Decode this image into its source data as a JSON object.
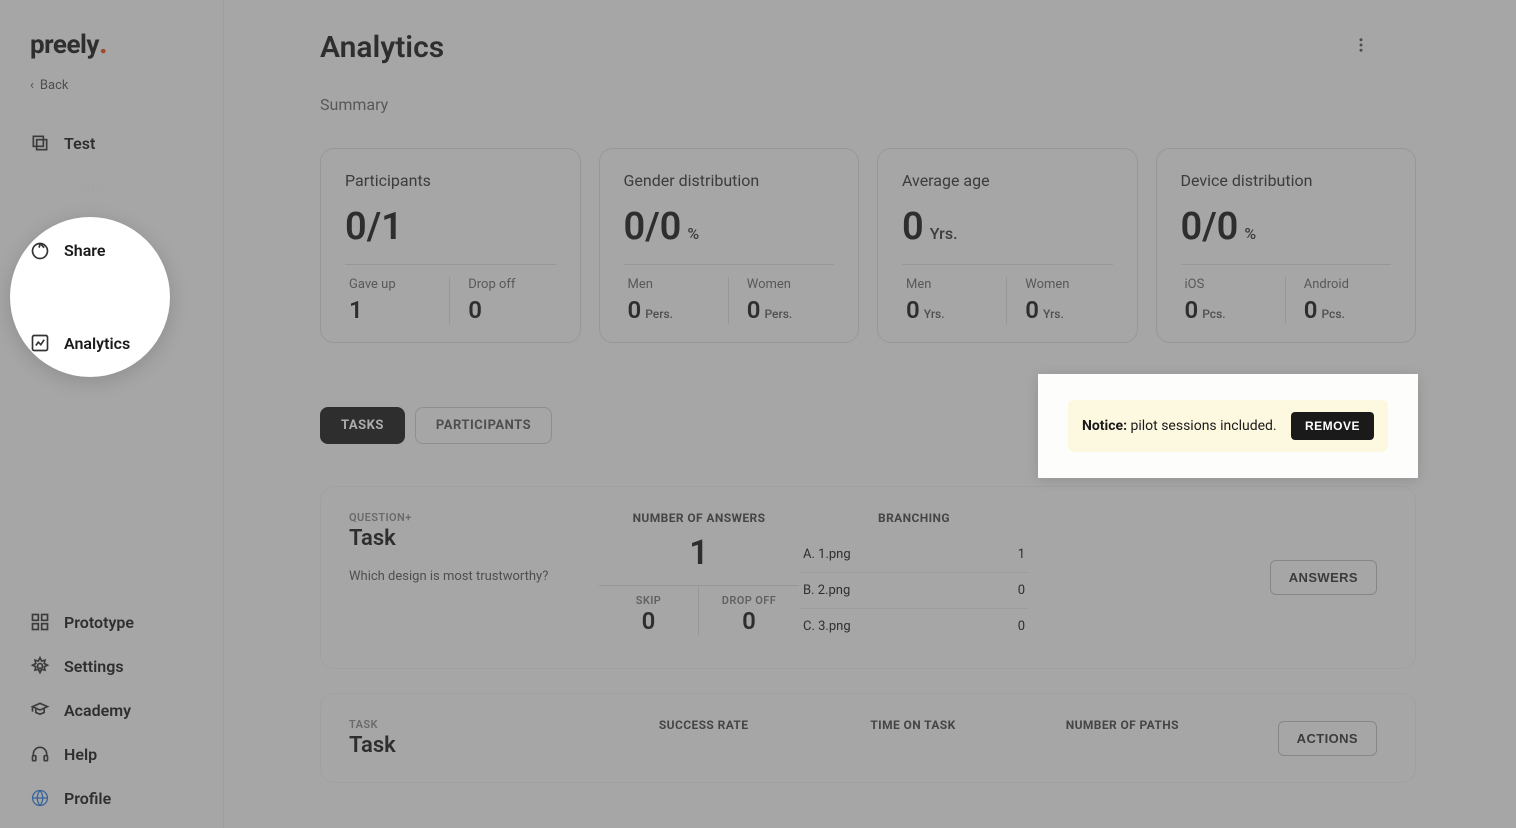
{
  "brand": "preely",
  "back_label": "Back",
  "sidebar": {
    "top": [
      {
        "label": "Test",
        "icon": "test"
      },
      {
        "label": "Share",
        "icon": "share"
      },
      {
        "label": "Analytics",
        "icon": "analytics"
      }
    ],
    "bottom": [
      {
        "label": "Prototype",
        "icon": "prototype"
      },
      {
        "label": "Settings",
        "icon": "settings"
      },
      {
        "label": "Academy",
        "icon": "academy"
      },
      {
        "label": "Help",
        "icon": "help"
      },
      {
        "label": "Profile",
        "icon": "profile"
      }
    ]
  },
  "page_title": "Analytics",
  "summary_label": "Summary",
  "cards": {
    "participants": {
      "title": "Participants",
      "value": "0/1",
      "sub1_label": "Gave up",
      "sub1_value": "1",
      "sub2_label": "Drop off",
      "sub2_value": "0"
    },
    "gender": {
      "title": "Gender distribution",
      "value": "0/0",
      "unit": "%",
      "sub1_label": "Men",
      "sub1_value": "0",
      "sub1_unit": "Pers.",
      "sub2_label": "Women",
      "sub2_value": "0",
      "sub2_unit": "Pers."
    },
    "age": {
      "title": "Average age",
      "value": "0",
      "unit": "Yrs.",
      "sub1_label": "Men",
      "sub1_value": "0",
      "sub1_unit": "Yrs.",
      "sub2_label": "Women",
      "sub2_value": "0",
      "sub2_unit": "Yrs."
    },
    "device": {
      "title": "Device distribution",
      "value": "0/0",
      "unit": "%",
      "sub1_label": "iOS",
      "sub1_value": "0",
      "sub1_unit": "Pcs.",
      "sub2_label": "Android",
      "sub2_value": "0",
      "sub2_unit": "Pcs."
    }
  },
  "tabs": {
    "tasks": "TASKS",
    "participants": "PARTICIPANTS"
  },
  "notice": {
    "bold": "Notice:",
    "text": " pilot sessions included.",
    "button": "REMOVE"
  },
  "task1": {
    "kind": "QUESTION+",
    "title": "Task",
    "question": "Which design is most trustworthy?",
    "answers_hdr": "NUMBER OF ANSWERS",
    "answers_val": "1",
    "skip_label": "SKIP",
    "skip_val": "0",
    "drop_label": "DROP OFF",
    "drop_val": "0",
    "branch_hdr": "BRANCHING",
    "branches": [
      {
        "label": "A. 1.png",
        "value": "1"
      },
      {
        "label": "B. 2.png",
        "value": "0"
      },
      {
        "label": "C. 3.png",
        "value": "0"
      }
    ],
    "answers_btn": "ANSWERS"
  },
  "task2": {
    "kind": "TASK",
    "title": "Task",
    "success_hdr": "SUCCESS RATE",
    "time_hdr": "TIME ON TASK",
    "paths_hdr": "NUMBER OF PATHS",
    "actions_btn": "ACTIONS"
  }
}
